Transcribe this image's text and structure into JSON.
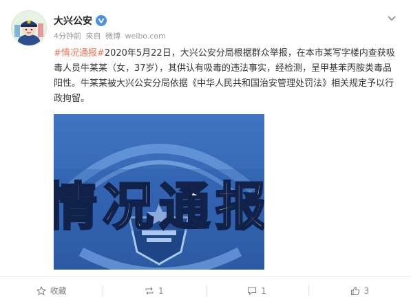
{
  "post": {
    "author": "大兴公安",
    "meta": {
      "time": "4分钟前",
      "source_prefix": "来自",
      "source": "微博",
      "site": "weibo.com"
    },
    "topic": "#情况通报#",
    "body": "2020年5月22日，大兴公安分局根据群众举报，在本市某写字楼内查获吸毒人员牛某某（女，37岁），其供认有吸毒的违法事实，经检测，呈甲基苯丙胺类毒品阳性。牛某某被大兴公安分局依据《中华人民共和国治安管理处罚法》相关规定予以行政拘留。",
    "image_heading": "情况通报"
  },
  "actions": {
    "favorite_label": "收藏",
    "repost_count": "1",
    "comment_count": "1",
    "like_count": "3"
  },
  "colors": {
    "topic": "#eb7350",
    "verified_badge": "#4b8ee8",
    "photo_blue": "#3566b4"
  }
}
